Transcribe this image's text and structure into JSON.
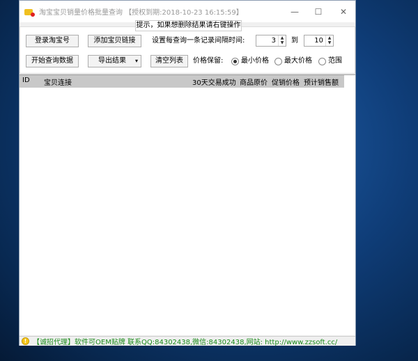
{
  "window": {
    "title": "淘宝宝贝销量价格批量查询 【授权到期:2018-10-23 16:15:59】",
    "minimize": "—",
    "maximize": "☐",
    "close": "✕"
  },
  "tip": "提示，如果想删除结果请右键操作",
  "toolbar": {
    "login": "登录淘宝号",
    "add_link": "添加宝贝链接",
    "interval_label": "设置每查询一条记录间隔时间:",
    "interval_from": "3",
    "to_label": "到",
    "interval_to": "10",
    "start": "开始查询数据",
    "export": "导出结果",
    "export_caret": "▾",
    "clear": "清空列表",
    "price_keep_label": "价格保留:",
    "radios": [
      {
        "label": "最小价格",
        "checked": true
      },
      {
        "label": "最大价格",
        "checked": false
      },
      {
        "label": "范围",
        "checked": false
      }
    ]
  },
  "table": {
    "columns": [
      "ID",
      "宝贝连接",
      "30天交易成功",
      "商品原价",
      "促销价格",
      "预计销售额"
    ],
    "rows": []
  },
  "status": {
    "icon": "!",
    "text": "【诚招代理】软件可OEM贴牌 联系QQ:84302438,微信:84302438,网站: http://www.zzsoft.cc/"
  }
}
